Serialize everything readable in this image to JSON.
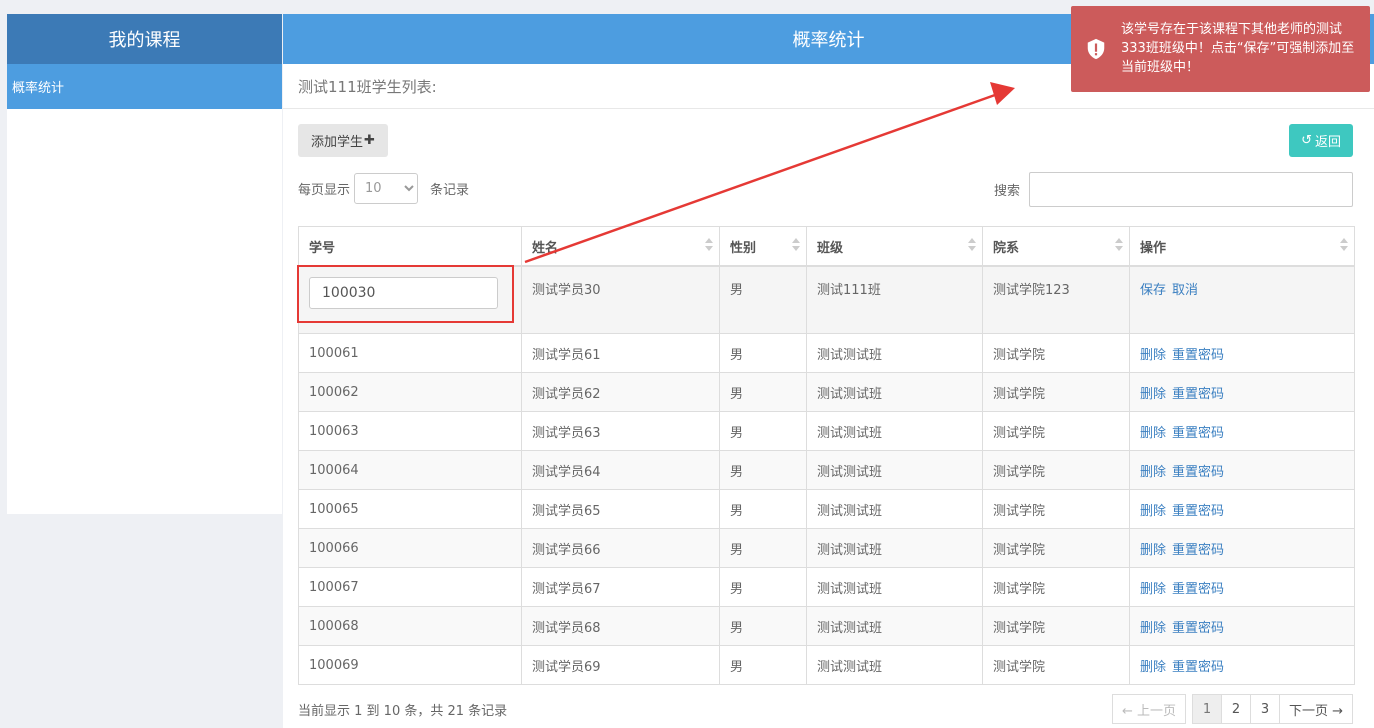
{
  "sidebar": {
    "title": "我的课程",
    "items": [
      {
        "label": "概率统计"
      }
    ]
  },
  "main": {
    "header_title": "概率统计",
    "subtitle": "测试111班学生列表:",
    "add_button": "添加学生",
    "back_button": "返回",
    "length_prefix": "每页显示",
    "length_value": "10",
    "length_suffix": "条记录",
    "search_label": "搜索"
  },
  "table": {
    "columns": [
      "学号",
      "姓名",
      "性别",
      "班级",
      "院系",
      "操作"
    ],
    "edit_row": {
      "id": "100030",
      "name": "测试学员30",
      "gender": "男",
      "class": "测试111班",
      "dept": "测试学院123",
      "save": "保存",
      "cancel": "取消"
    },
    "rows": [
      {
        "id": "100061",
        "name": "测试学员61",
        "gender": "男",
        "class": "测试测试班",
        "dept": "测试学院",
        "delete": "删除",
        "reset": "重置密码"
      },
      {
        "id": "100062",
        "name": "测试学员62",
        "gender": "男",
        "class": "测试测试班",
        "dept": "测试学院",
        "delete": "删除",
        "reset": "重置密码"
      },
      {
        "id": "100063",
        "name": "测试学员63",
        "gender": "男",
        "class": "测试测试班",
        "dept": "测试学院",
        "delete": "删除",
        "reset": "重置密码"
      },
      {
        "id": "100064",
        "name": "测试学员64",
        "gender": "男",
        "class": "测试测试班",
        "dept": "测试学院",
        "delete": "删除",
        "reset": "重置密码"
      },
      {
        "id": "100065",
        "name": "测试学员65",
        "gender": "男",
        "class": "测试测试班",
        "dept": "测试学院",
        "delete": "删除",
        "reset": "重置密码"
      },
      {
        "id": "100066",
        "name": "测试学员66",
        "gender": "男",
        "class": "测试测试班",
        "dept": "测试学院",
        "delete": "删除",
        "reset": "重置密码"
      },
      {
        "id": "100067",
        "name": "测试学员67",
        "gender": "男",
        "class": "测试测试班",
        "dept": "测试学院",
        "delete": "删除",
        "reset": "重置密码"
      },
      {
        "id": "100068",
        "name": "测试学员68",
        "gender": "男",
        "class": "测试测试班",
        "dept": "测试学院",
        "delete": "删除",
        "reset": "重置密码"
      },
      {
        "id": "100069",
        "name": "测试学员69",
        "gender": "男",
        "class": "测试测试班",
        "dept": "测试学院",
        "delete": "删除",
        "reset": "重置密码"
      }
    ]
  },
  "footer": {
    "info": "当前显示 1 到 10 条，共 21 条记录",
    "prev": "← 上一页",
    "pages": [
      "1",
      "2",
      "3"
    ],
    "next": "下一页 →"
  },
  "toast": {
    "message": "该学号存在于该课程下其他老师的测试333班班级中！点击“保存”可强制添加至当前班级中！",
    "color": "#cc5b5b"
  },
  "colors": {
    "sidebar_header": "#3c7ab6",
    "accent": "#4d9de0",
    "back_button": "#3ec8c0",
    "highlight": "#e53935"
  }
}
